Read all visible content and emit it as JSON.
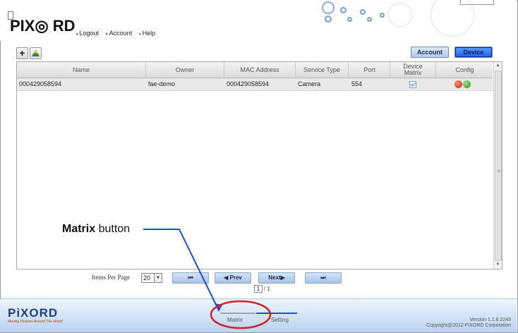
{
  "header": {
    "logo_text": "PIX◎ RD",
    "nav": [
      "Logout",
      "Account",
      "Help"
    ]
  },
  "toolbar": {
    "add_symbol": "+",
    "account_tab": "Account",
    "device_tab": "Device"
  },
  "table": {
    "headers": [
      "Name",
      "Owner",
      "MAC Address",
      "Service Type",
      "Port",
      "Device Matrix",
      "Config"
    ],
    "rows": [
      {
        "name": "000429058594",
        "owner": "fae-demo",
        "mac": "000429058594",
        "service_type": "Camera",
        "port": "554",
        "device_matrix": true
      }
    ]
  },
  "pager": {
    "items_per_page_label": "Items Per Page",
    "items_per_page_value": "20",
    "first_label": "⏮",
    "prev_label": "◀ Prev",
    "next_label": "Next▶",
    "last_label": "⏭",
    "current_page": "1",
    "total_pages": "/ 1"
  },
  "footer": {
    "logo": "PiXORD",
    "tagline": "Moving Pictures Around The World",
    "tab_matrix": "Matrix",
    "tab_setting": "Setting",
    "version": "Version 1.1.8.2243",
    "copyright": "Copyright@2012 PIXORD Corporation"
  },
  "annotation": {
    "bold": "Matrix",
    "rest": " button"
  },
  "colors": {
    "accent_blue": "#1f5ee8",
    "callout_red": "#d42020",
    "arrow_blue": "#1a4fd6"
  }
}
